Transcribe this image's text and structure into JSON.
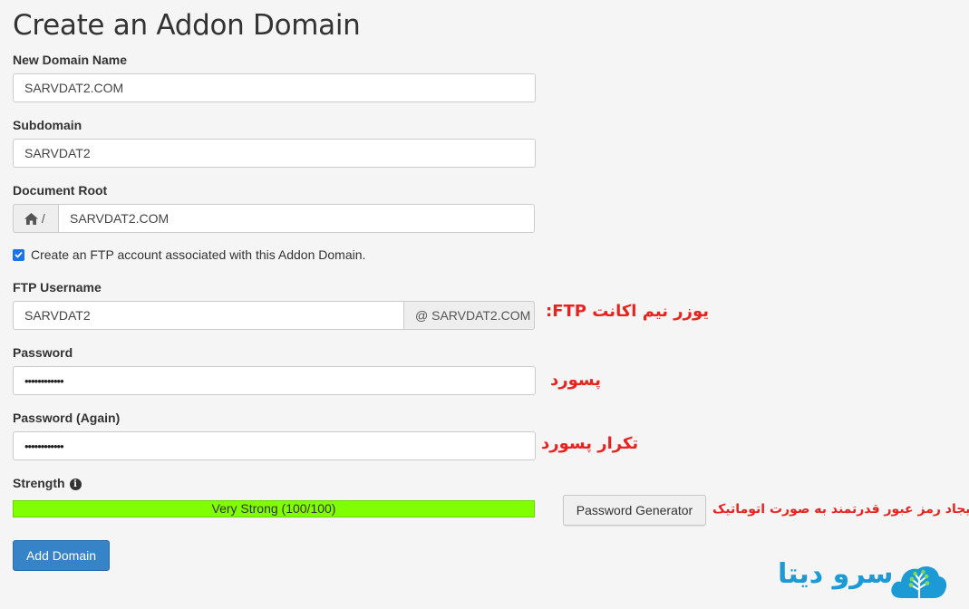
{
  "page": {
    "title": "Create an Addon Domain"
  },
  "form": {
    "new_domain": {
      "label": "New Domain Name",
      "value": "SARVDAT2.COM"
    },
    "subdomain": {
      "label": "Subdomain",
      "value": "SARVDAT2"
    },
    "document_root": {
      "label": "Document Root",
      "prefix": "/",
      "value": "SARVDAT2.COM"
    },
    "ftp_checkbox": {
      "label": "Create an FTP account associated with this Addon Domain.",
      "checked": true
    },
    "ftp_username": {
      "label": "FTP Username",
      "value": "SARVDAT2",
      "suffix": "@ SARVDAT2.COM"
    },
    "password": {
      "label": "Password",
      "value": "••••••••••••"
    },
    "password_again": {
      "label": "Password (Again)",
      "value": "••••••••••••"
    },
    "strength": {
      "label": "Strength",
      "text": "Very Strong (100/100)",
      "score": 100,
      "color": "#7fff00"
    },
    "password_generator_label": "Password Generator",
    "add_domain_label": "Add Domain"
  },
  "annotations": {
    "ftp_username": "یوزر نیم اکانت FTP:",
    "password": "پسورد",
    "password_again": "تکرار پسورد",
    "generator": "ایجاد رمز عبور قدرتمند به صورت اتوماتیک"
  },
  "logo": {
    "text": "سرو دیتا",
    "icon": "tree-cloud-icon"
  },
  "colors": {
    "primary_button": "#3683c7",
    "annotation": "#e8231f",
    "logo": "#1b9ad6"
  }
}
